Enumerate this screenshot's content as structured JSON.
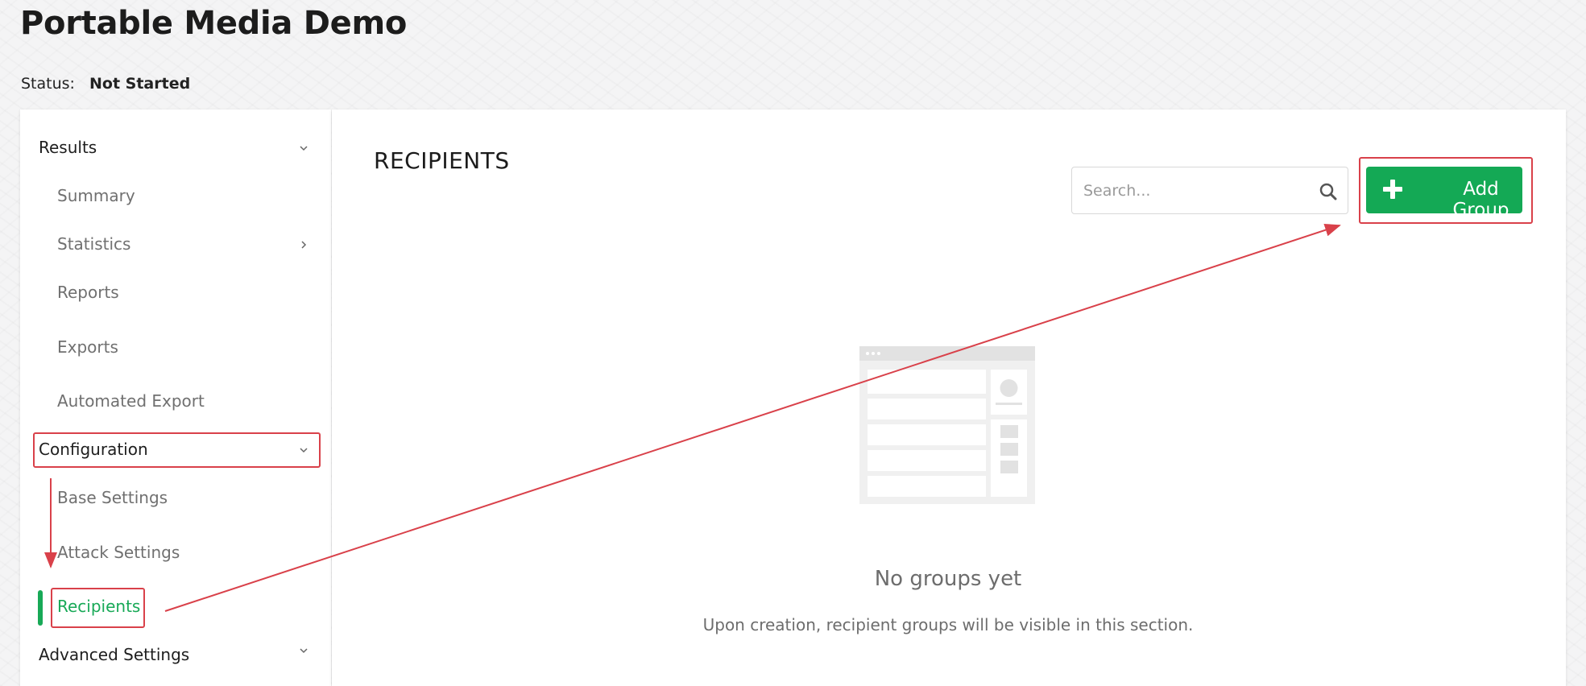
{
  "page": {
    "title": "Portable Media Demo",
    "status_label": "Status:",
    "status_value": "Not Started"
  },
  "sidebar": {
    "sections": [
      {
        "label": "Results",
        "expanded": true,
        "chevron": "chevron-down-icon",
        "items": [
          {
            "label": "Summary"
          },
          {
            "label": "Statistics",
            "chevron": "chevron-right-icon"
          },
          {
            "label": "Reports"
          },
          {
            "label": "Exports"
          },
          {
            "label": "Automated Export"
          }
        ]
      },
      {
        "label": "Configuration",
        "expanded": true,
        "chevron": "chevron-down-icon",
        "items": [
          {
            "label": "Base Settings"
          },
          {
            "label": "Attack Settings"
          },
          {
            "label": "Recipients",
            "active": true
          }
        ]
      },
      {
        "label": "Advanced Settings",
        "expanded": false,
        "chevron": "chevron-down-icon"
      }
    ]
  },
  "main": {
    "title": "RECIPIENTS",
    "search_placeholder": "Search...",
    "search_value": "",
    "add_button_label": "Add Group",
    "empty_title": "No groups yet",
    "empty_description": "Upon creation, recipient groups will be visible in this section."
  },
  "colors": {
    "accent": "#18a957",
    "annotation": "#d9414a"
  }
}
